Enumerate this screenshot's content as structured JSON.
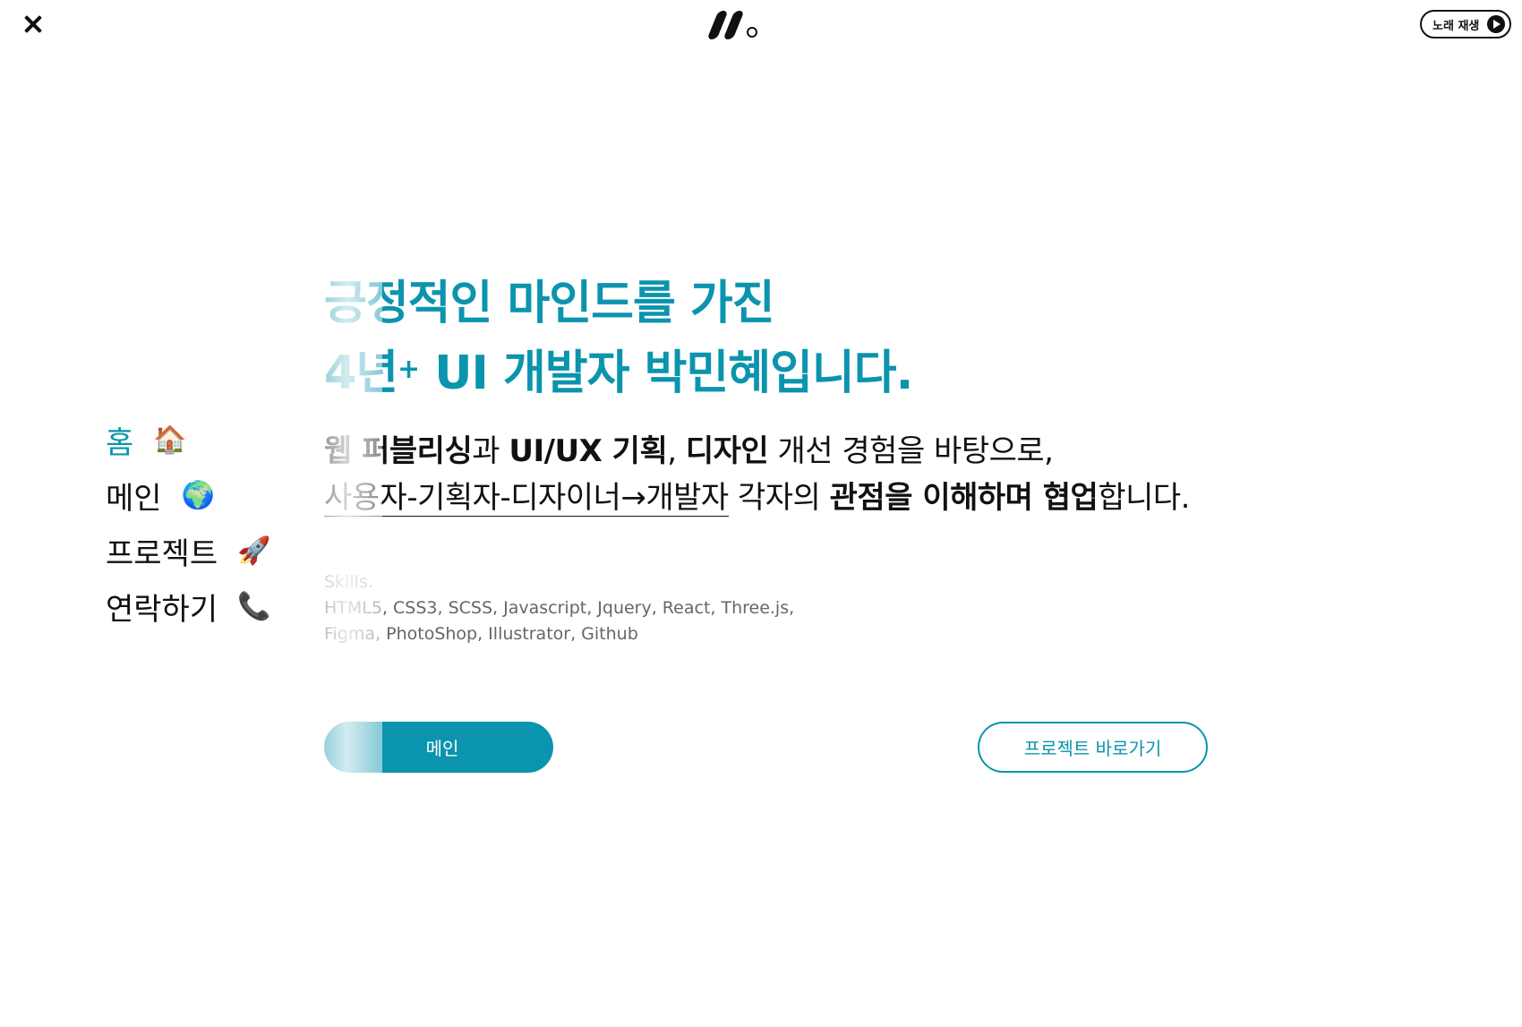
{
  "header": {
    "close_icon": "close-icon",
    "logo_icon": "logo-icon",
    "music_label": "노래 재생",
    "music_icon": "play-circle-icon"
  },
  "nav": {
    "items": [
      {
        "label": "홈",
        "icon": "🏠",
        "active": true
      },
      {
        "label": "메인",
        "icon": "🌍",
        "active": false
      },
      {
        "label": "프로젝트",
        "icon": "🚀",
        "active": false
      },
      {
        "label": "연락하기",
        "icon": "📞",
        "active": false
      }
    ]
  },
  "hero": {
    "line1": "긍정적인 마인드를 가진",
    "line2_prefix": "4년",
    "line2_sup": "+",
    "line2_rest": " UI 개발자 박민혜입니다.",
    "intro": {
      "p1_b1": "웹 퍼블리싱",
      "p1_t1": "과 ",
      "p1_b2": "UI/UX 기획",
      "p1_t2": ", ",
      "p1_b3": "디자인",
      "p1_t3": " 개선 경험을 바탕으로,",
      "p2_link": "사용자-기획자-디자이너→개발자",
      "p2_t1": " 각자의 ",
      "p2_b1": "관점을 이해하며 협업",
      "p2_t2": "합니다."
    },
    "stack": {
      "title": "Skills.",
      "line1": "HTML5, CSS3, SCSS, Javascript, Jquery, React, Three.js,",
      "line2": "Figma, PhotoShop, Illustrator, Github"
    }
  },
  "buttons": {
    "main": "메인",
    "project": "프로젝트 바로가기"
  },
  "colors": {
    "accent": "#0b94ad",
    "text": "#111111"
  }
}
